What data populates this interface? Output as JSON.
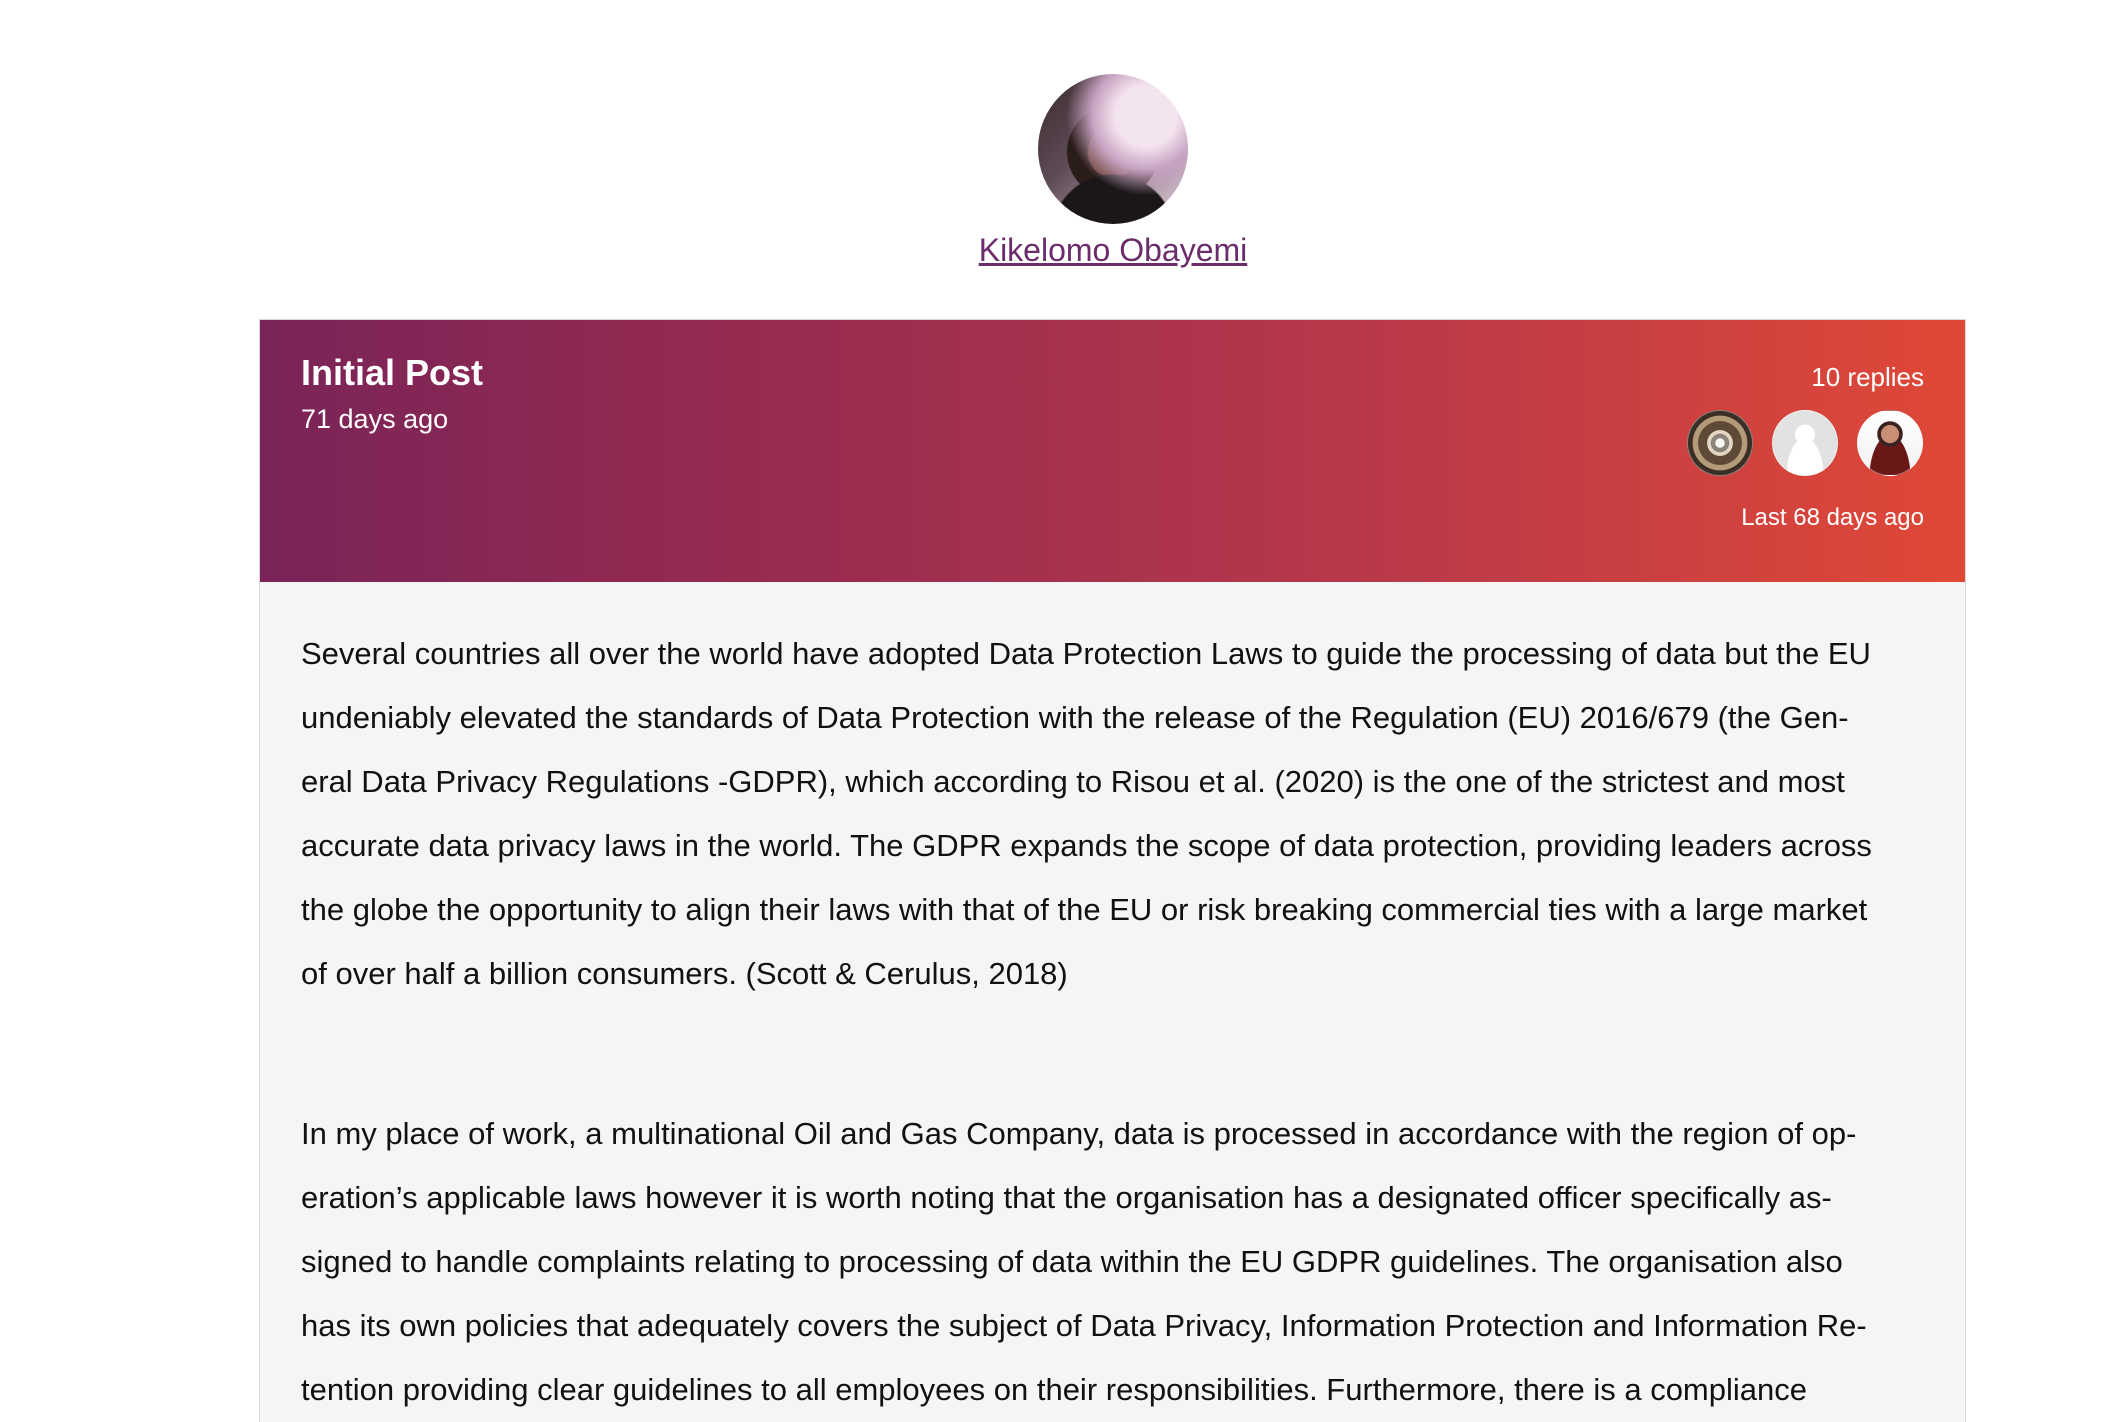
{
  "author": {
    "name": "Kikelomo Obayemi"
  },
  "post": {
    "title": "Initial Post",
    "time": "71 days ago",
    "replies": "10 replies",
    "last_reply": "Last 68 days ago",
    "paragraph1_lines": [
      "Several countries all over the world have adopted Data Protection Laws to guide the processing of data but the EU",
      "undeniably elevated the standards of Data Protection with the release of the Regulation (EU) 2016/679 (the Gen-",
      "eral Data Privacy Regulations -GDPR), which according to Risou et al. (2020) is the one of the strictest and most",
      "accurate data privacy laws in the world. The GDPR expands the scope of data protection, providing leaders across",
      "the globe the opportunity to align their laws with that of the EU or risk breaking commercial ties with a large market",
      "of over half a billion consumers. (Scott & Cerulus, 2018)"
    ],
    "paragraph2_lines": [
      "In my place of work, a multinational Oil and Gas Company, data is processed in accordance with the region of op-",
      "eration’s applicable laws however it is worth noting that the organisation has a designated officer specifically as-",
      "signed to handle complaints relating to processing of data within the EU GDPR guidelines. The organisation also",
      "has its own policies that adequately covers the subject of Data Privacy, Information Protection and Information Re-",
      "tention providing clear guidelines to all employees on their responsibilities.  Furthermore, there is a compliance"
    ]
  }
}
